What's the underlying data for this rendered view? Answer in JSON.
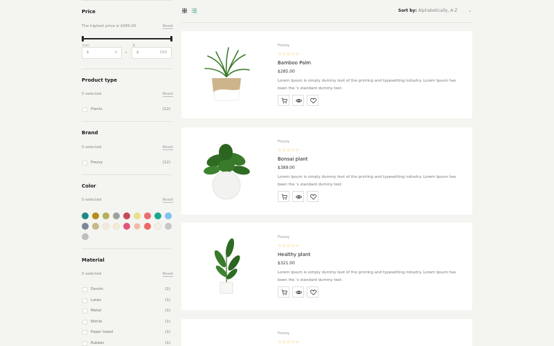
{
  "filters": {
    "price": {
      "title": "Price",
      "highest_label": "The highest price is $589.00",
      "reset": "Reset",
      "from_label": "From",
      "to_label": "To",
      "from_currency": "$",
      "from_value": "0",
      "to_currency": "$",
      "to_value": "589",
      "range_separator": "-"
    },
    "product_type": {
      "title": "Product type",
      "selected": "0 selected",
      "reset": "Reset",
      "items": [
        {
          "label": "Plants",
          "count": "(12)"
        }
      ]
    },
    "brand": {
      "title": "Brand",
      "selected": "0 selected",
      "reset": "Reset",
      "items": [
        {
          "label": "Frezzy",
          "count": "(12)"
        }
      ]
    },
    "color": {
      "title": "Color",
      "selected": "0 selected",
      "reset": "Reset",
      "swatches": [
        "#1e8b83",
        "#b58c1d",
        "#b5b05a",
        "#a0a0a0",
        "#c64b57",
        "#e8e08a",
        "#e86c72",
        "#1ea58f",
        "#7ec3f0",
        "#7d8696",
        "#c8b98a",
        "#f3eadb",
        "#f4ecd3",
        "#e2567e",
        "#f3b9a0",
        "#ec6a63",
        "#f6eee8",
        "#c7c7c7",
        "#bfbfbf"
      ]
    },
    "material": {
      "title": "Material",
      "selected": "0 selected",
      "reset": "Reset",
      "items": [
        {
          "label": "Denim",
          "count": "(1)"
        },
        {
          "label": "Latex",
          "count": "(1)"
        },
        {
          "label": "Metal",
          "count": "(1)"
        },
        {
          "label": "Nitrile",
          "count": "(1)"
        },
        {
          "label": "Paper towel",
          "count": "(1)"
        },
        {
          "label": "Rubber",
          "count": "(1)"
        }
      ]
    }
  },
  "toolbar": {
    "grid_icon": "grid-icon",
    "list_icon": "list-icon",
    "sort_label": "Sort by:",
    "sort_value": "Alphabetically, A-Z",
    "sort_chevron": "⌄"
  },
  "products": [
    {
      "brand": "Frezzy",
      "stars": "☆☆☆☆☆",
      "name": "Bamboo Palm",
      "price": "$285.00",
      "description": "Lorem Ipsum is simply dummy text of the printing and typesetting industry. Lorem Ipsum has been the 's standard dummy text."
    },
    {
      "brand": "Frezzy",
      "stars": "☆☆☆☆☆",
      "name": "Bonsai plant",
      "price": "$389.00",
      "description": "Lorem Ipsum is simply dummy text of the printing and typesetting industry. Lorem Ipsum has been the 's standard dummy text."
    },
    {
      "brand": "Frezzy",
      "stars": "☆☆☆☆☆",
      "name": "Healthy plant",
      "price": "$321.00",
      "description": "Lorem Ipsum is simply dummy text of the printing and typesetting industry. Lorem Ipsum has been the 's standard dummy text."
    },
    {
      "brand": "Frezzy",
      "stars": "☆☆☆☆☆",
      "name": "",
      "price": "",
      "description": ""
    }
  ],
  "colors": {
    "accent_star": "#f0b429",
    "active_view": "#3fa58b"
  }
}
